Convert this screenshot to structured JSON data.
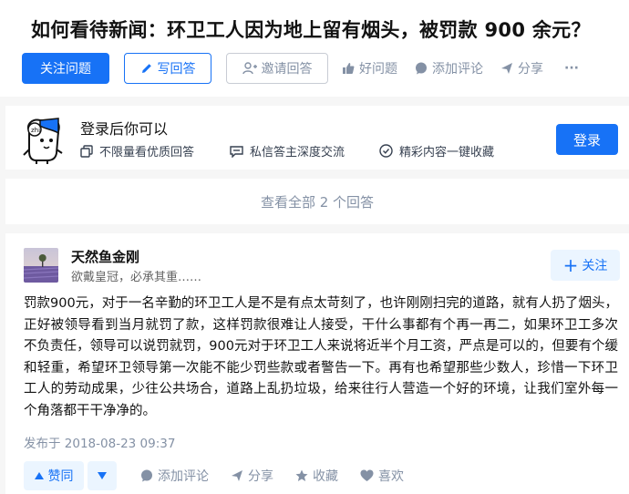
{
  "question": {
    "title": "如何看待新闻：环卫工人因为地上留有烟头，被罚款 900 余元？",
    "follow_label": "关注问题",
    "write_label": "写回答",
    "invite_label": "邀请回答",
    "good_label": "好问题",
    "comment_label": "添加评论",
    "share_label": "分享",
    "more_label": "···"
  },
  "login_banner": {
    "title": "登录后你可以",
    "perks": [
      "不限量看优质回答",
      "私信答主深度交流",
      "精彩内容一键收藏"
    ],
    "button_label": "登录"
  },
  "view_all_label": "查看全部 2 个回答",
  "answer": {
    "author_name": "天然鱼金刚",
    "author_bio": "欲戴皇冠，必承其重……",
    "follow_label": "关注",
    "content": "罚款900元，对于一名辛勤的环卫工人是不是有点太苛刻了，也许刚刚扫完的道路，就有人扔了烟头，正好被领导看到当月就罚了款，这样罚款很难让人接受，干什么事都有个再一再二，如果环卫工多次不负责任，领导可以说罚就罚，900元对于环卫工人来说将近半个月工资，严点是可以的，但要有个缓和轻重，希望环卫领导第一次能不能少罚些款或者警告一下。再有也希望那些少数人，珍惜一下环卫工人的劳动成果，少往公共场合，道路上乱扔垃圾，给来往行人营造一个好的环境，让我们室外每一个角落都干干净净的。",
    "published": "发布于 2018-08-23 09:37",
    "upvote_label": "赞同",
    "comment_label": "添加评论",
    "share_label": "分享",
    "collect_label": "收藏",
    "like_label": "喜欢"
  },
  "colors": {
    "brand": "#1772f6",
    "gray": "#8491a5",
    "background": "#f6f6f6"
  }
}
